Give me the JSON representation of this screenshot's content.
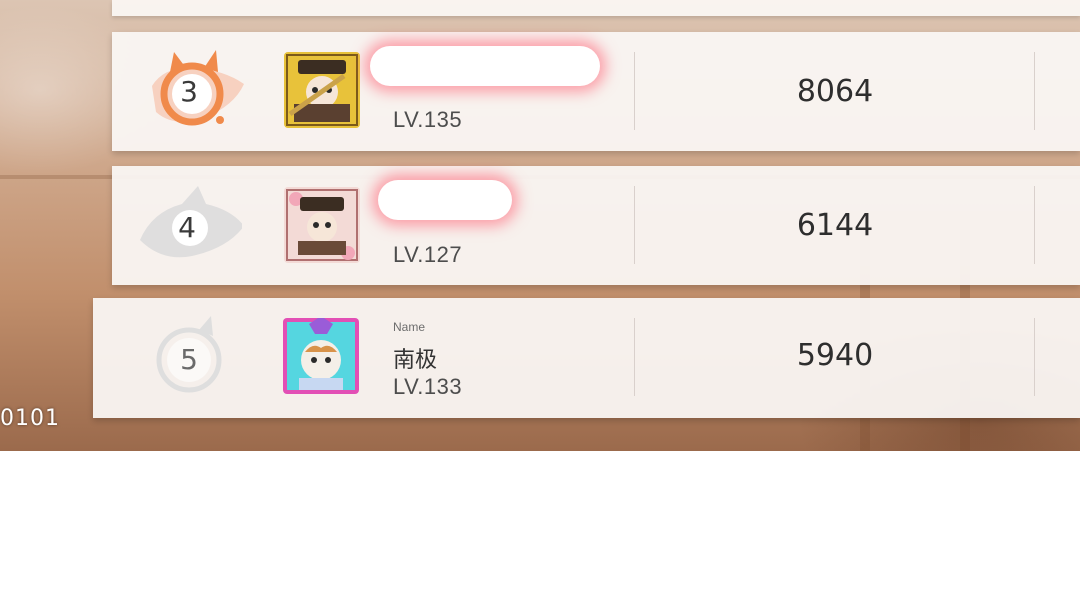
{
  "footer_code": "0101",
  "leaderboard": [
    {
      "rank": "3",
      "level": "LV.135",
      "score": "8064",
      "name_tag": "",
      "name": "",
      "rank_color": "#f08a4b"
    },
    {
      "rank": "4",
      "level": "LV.127",
      "score": "6144",
      "name_tag": "",
      "name": "",
      "rank_color": "#cccccc"
    },
    {
      "rank": "5",
      "level": "LV.133",
      "score": "5940",
      "name_tag": "Name",
      "name": "南极",
      "rank_color": "#d6d6d6"
    }
  ]
}
